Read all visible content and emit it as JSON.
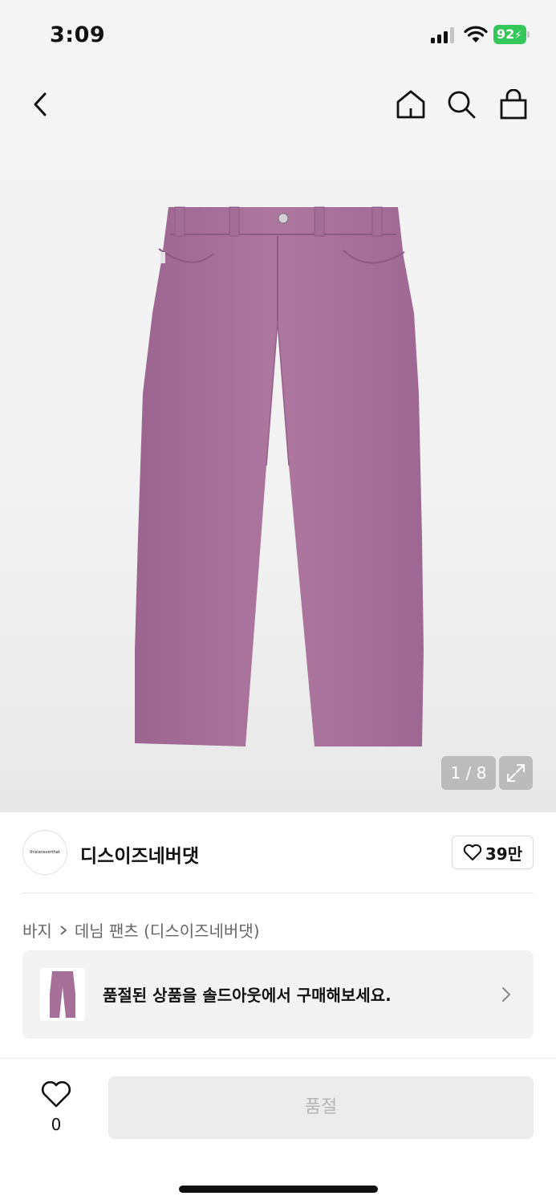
{
  "status_bar": {
    "time": "3:09",
    "battery": "92"
  },
  "gallery": {
    "counter": "1 / 8"
  },
  "brand": {
    "logo_text": "thisisneverthat",
    "name": "디스이즈네버댓",
    "likes": "39만"
  },
  "breadcrumb": {
    "category": "바지",
    "subcategory": "데님 팬츠 (디스이즈네버댓)"
  },
  "soldout_banner": {
    "text": "품절된 상품을 솔드아웃에서 구매해보세요."
  },
  "bottom_bar": {
    "wish_count": "0",
    "buy_label": "품절"
  },
  "colors": {
    "product": "#a66f98",
    "battery": "#34c759",
    "accent": "#111111"
  }
}
